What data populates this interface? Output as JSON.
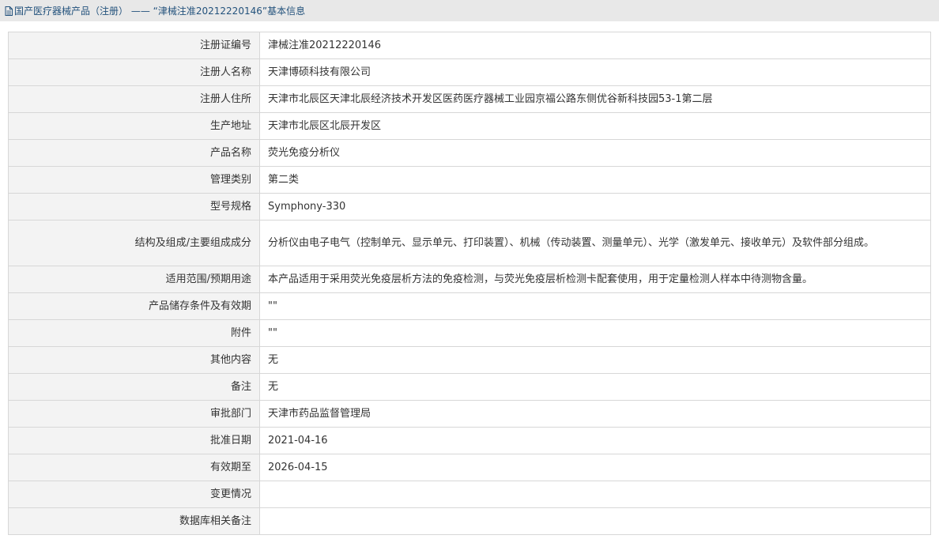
{
  "breadcrumb": {
    "link": "国产医疗器械产品（注册）",
    "separator": " —— ",
    "current": "“津械注准20212220146”基本信息"
  },
  "fields": [
    {
      "label": "注册证编号",
      "value": "津械注准20212220146"
    },
    {
      "label": "注册人名称",
      "value": "天津博硕科技有限公司"
    },
    {
      "label": "注册人住所",
      "value": "天津市北辰区天津北辰经济技术开发区医药医疗器械工业园京福公路东侧优谷新科技园53-1第二层"
    },
    {
      "label": "生产地址",
      "value": "天津市北辰区北辰开发区"
    },
    {
      "label": "产品名称",
      "value": "荧光免疫分析仪"
    },
    {
      "label": "管理类别",
      "value": "第二类"
    },
    {
      "label": "型号规格",
      "value": "Symphony-330"
    },
    {
      "label": "结构及组成/主要组成成分",
      "value": "分析仪由电子电气（控制单元、显示单元、打印装置）、机械（传动装置、测量单元）、光学（激发单元、接收单元）及软件部分组成。"
    },
    {
      "label": "适用范围/预期用途",
      "value": "本产品适用于采用荧光免疫层析方法的免疫检测，与荧光免疫层析检测卡配套使用，用于定量检测人样本中待测物含量。"
    },
    {
      "label": "产品储存条件及有效期",
      "value": "\"\""
    },
    {
      "label": "附件",
      "value": "\"\""
    },
    {
      "label": "其他内容",
      "value": "无"
    },
    {
      "label": "备注",
      "value": "无"
    },
    {
      "label": "审批部门",
      "value": "天津市药品监督管理局"
    },
    {
      "label": "批准日期",
      "value": "2021-04-16"
    },
    {
      "label": "有效期至",
      "value": "2026-04-15"
    },
    {
      "label": "变更情况",
      "value": ""
    },
    {
      "label": "数据库相关备注",
      "value": ""
    }
  ]
}
